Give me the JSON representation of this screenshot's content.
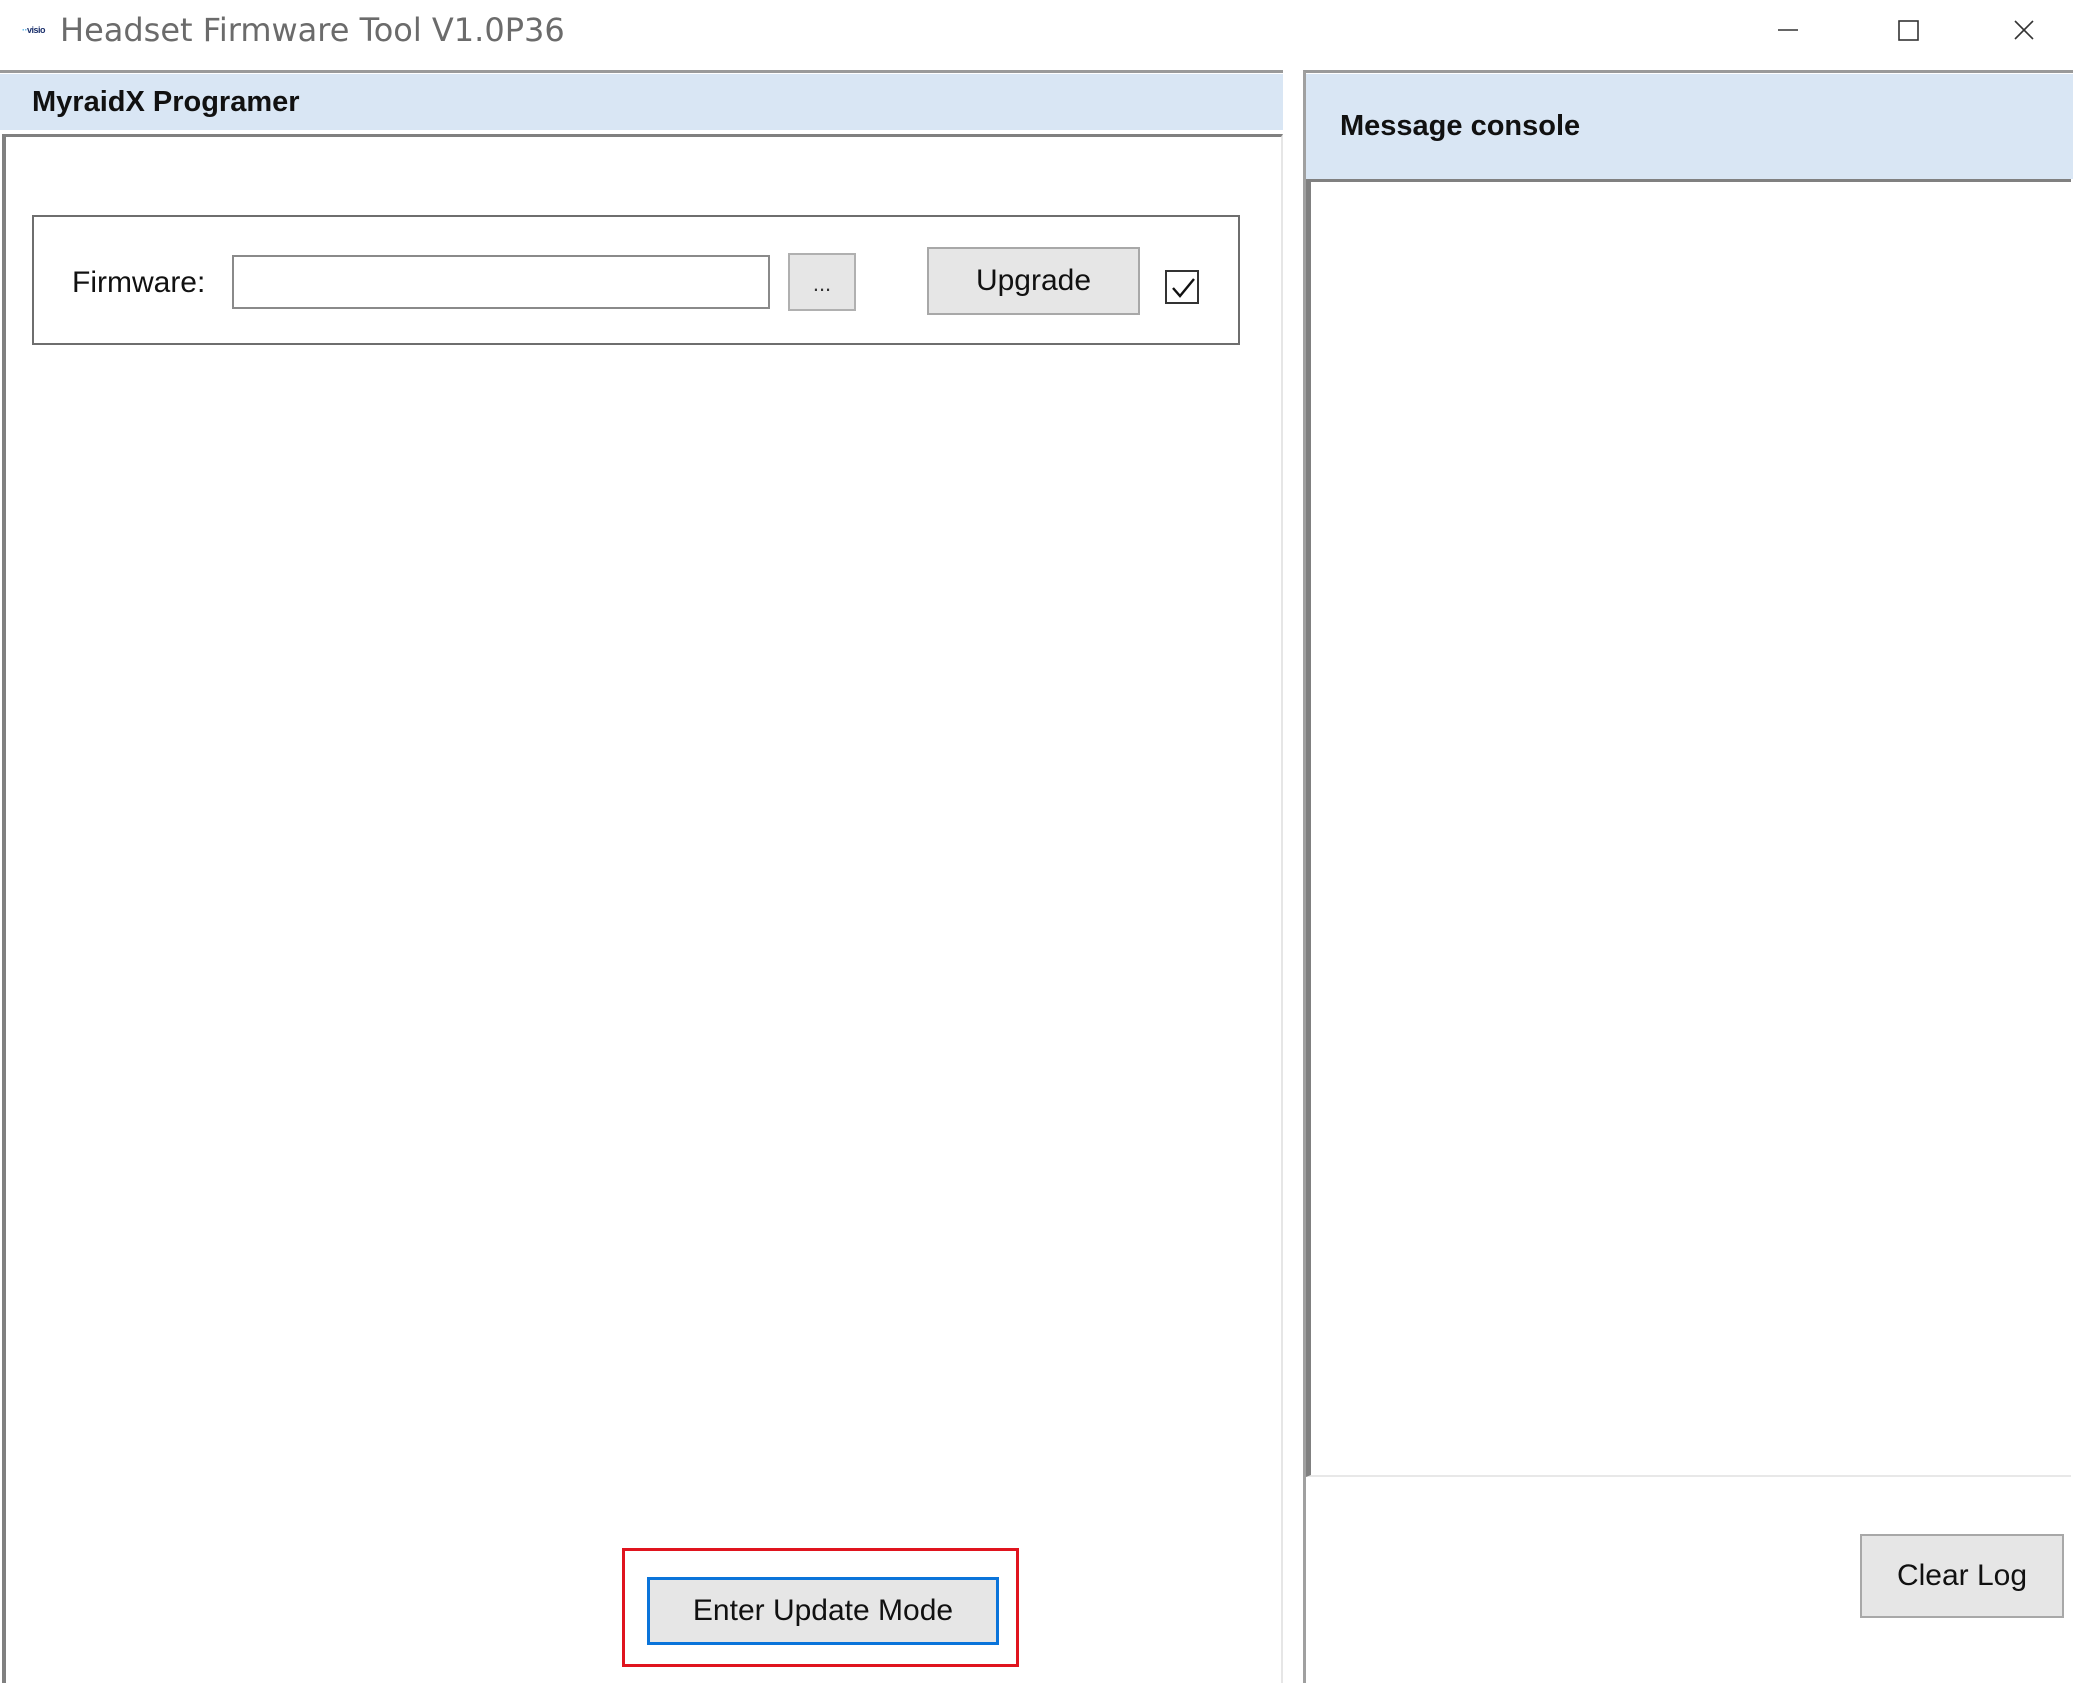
{
  "window": {
    "title": "Headset Firmware Tool V1.0P36",
    "app_icon_text": "visio",
    "minimize_label": "minimize",
    "maximize_label": "maximize",
    "close_label": "close"
  },
  "left_panel": {
    "title": "MyraidX Programer",
    "firmware_label": "Firmware:",
    "firmware_value": "",
    "browse_label": "...",
    "upgrade_label": "Upgrade",
    "checkbox_checked": true,
    "enter_update_label": "Enter Update Mode"
  },
  "right_panel": {
    "title": "Message console",
    "log_text": "",
    "clear_log_label": "Clear Log"
  },
  "colors": {
    "header_bg": "#d9e6f4",
    "highlight_border": "#e0141e",
    "focus_border": "#0a74da",
    "button_bg": "#e6e6e6"
  }
}
